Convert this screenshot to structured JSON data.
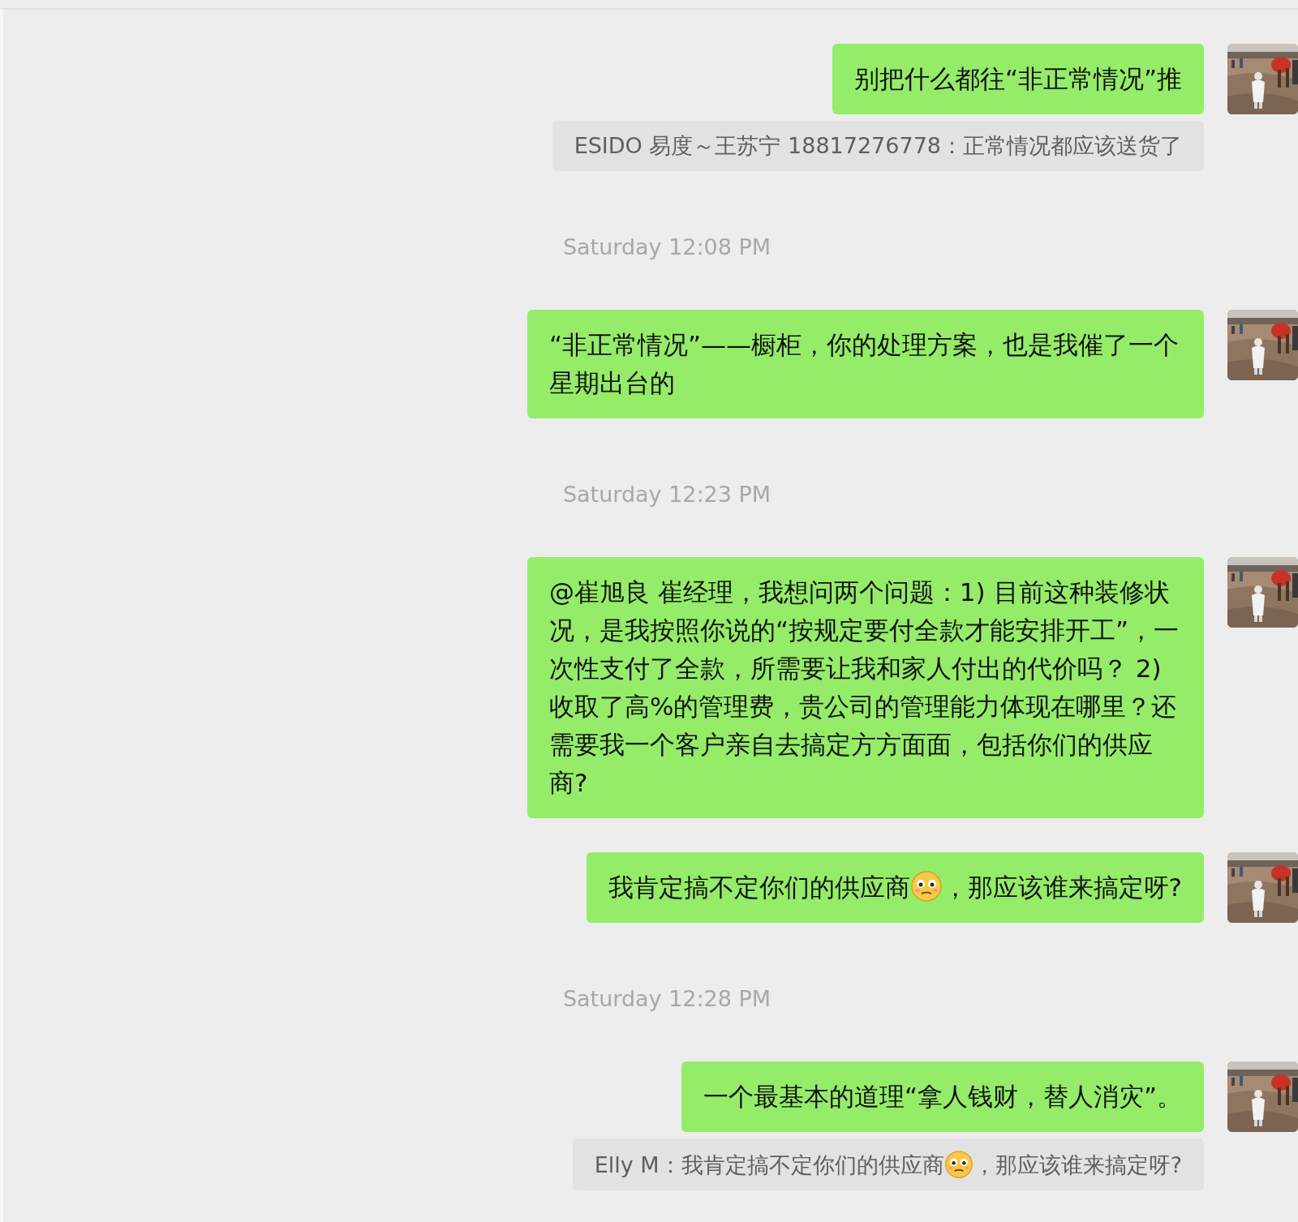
{
  "messages": [
    {
      "kind": "message",
      "parts": [
        {
          "kind": "text",
          "text": "别把什么都往“非正常情况”推"
        }
      ]
    },
    {
      "kind": "quote",
      "parts": [
        {
          "kind": "text",
          "text": "ESIDO 易度～王苏宁 18817276778：正常情况都应该送货了"
        }
      ]
    },
    {
      "kind": "timestamp",
      "text": "Saturday 12:08 PM"
    },
    {
      "kind": "message",
      "parts": [
        {
          "kind": "text",
          "text": "“非正常情况”——橱柜，你的处理方案，也是我催了一个星期出台的"
        }
      ]
    },
    {
      "kind": "timestamp",
      "text": "Saturday 12:23 PM"
    },
    {
      "kind": "message",
      "parts": [
        {
          "kind": "text",
          "text": "@崔旭良 崔经理，我想问两个问题：1) 目前这种装修状况，是我按照你说的“按规定要付全款才能安排开工”，一次性支付了全款，所需要让我和家人付出的代价吗？ 2) 收取了高%的管理费，贵公司的管理能力体现在哪里？还需要我一个客户亲自去搞定方方面面，包括你们的供应商?"
        }
      ]
    },
    {
      "kind": "message",
      "parts": [
        {
          "kind": "text",
          "text": "我肯定搞不定你们的供应商"
        },
        {
          "kind": "emoji"
        },
        {
          "kind": "text",
          "text": "，那应该谁来搞定呀?"
        }
      ]
    },
    {
      "kind": "timestamp",
      "text": "Saturday 12:28 PM"
    },
    {
      "kind": "message",
      "parts": [
        {
          "kind": "text",
          "text": "一个最基本的道理“拿人钱财，替人消灾”。"
        }
      ]
    },
    {
      "kind": "quote",
      "parts": [
        {
          "kind": "text",
          "text": "Elly M：我肯定搞不定你们的供应商"
        },
        {
          "kind": "emoji"
        },
        {
          "kind": "text",
          "text": "，那应该谁来搞定呀?"
        }
      ]
    }
  ]
}
